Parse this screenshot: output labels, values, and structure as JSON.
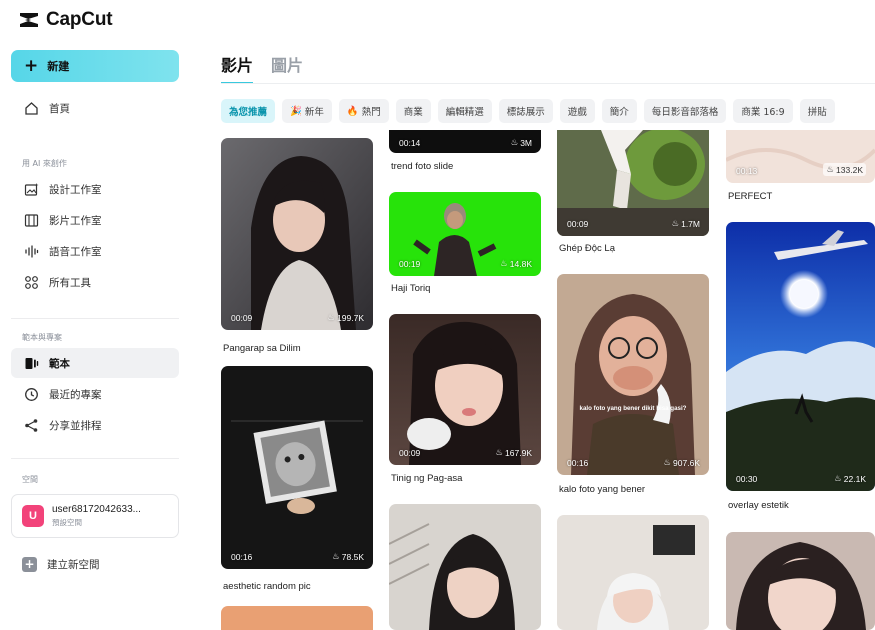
{
  "app": {
    "name": "CapCut"
  },
  "sidebar": {
    "new_label": "新建",
    "home_label": "首頁",
    "section_ai": "用 AI 來創作",
    "ai_items": [
      {
        "label": "設計工作室",
        "icon": "image-sparkle-icon"
      },
      {
        "label": "影片工作室",
        "icon": "film-icon"
      },
      {
        "label": "語音工作室",
        "icon": "waveform-icon"
      },
      {
        "label": "所有工具",
        "icon": "grid-icon"
      }
    ],
    "section_templates": "範本與專案",
    "template_items": [
      {
        "label": "範本",
        "icon": "template-icon"
      },
      {
        "label": "最近的專案",
        "icon": "clock-icon"
      },
      {
        "label": "分享並排程",
        "icon": "share-icon"
      }
    ],
    "section_space": "空間",
    "space": {
      "avatar_letter": "U",
      "name": "user68172042633...",
      "subtitle": "預設空間"
    },
    "new_space_label": "建立新空間"
  },
  "main": {
    "tabs": [
      "影片",
      "圖片"
    ],
    "chips": [
      "為您推薦",
      "新年",
      "熱門",
      "商業",
      "編輯精選",
      "標誌展示",
      "遊戲",
      "簡介",
      "每日影音部落格",
      "商業 16:9",
      "拼貼"
    ],
    "cards": [
      {
        "duration": "00:09",
        "views": "199.7K",
        "caption": "Pangarap sa Dilim"
      },
      {
        "duration": "00:16",
        "views": "78.5K",
        "caption": "aesthetic random pic"
      },
      {
        "duration": "00:14",
        "views": "3M",
        "caption": "trend foto slide"
      },
      {
        "duration": "00:19",
        "views": "14.8K",
        "caption": "Haji Toriq"
      },
      {
        "duration": "00:09",
        "views": "167.9K",
        "caption": "Tinig ng Pag-asa"
      },
      {
        "duration": "00:09",
        "views": "1.7M",
        "caption": "Ghép Độc Lạ"
      },
      {
        "duration": "00:16",
        "views": "907.6K",
        "caption": "kalo foto yang bener",
        "overlay": "kalo foto yang bener dikit bisa gasi?"
      },
      {
        "duration": "00:13",
        "views": "133.2K",
        "caption": "PERFECT"
      },
      {
        "duration": "00:30",
        "views": "22.1K",
        "caption": "overlay estetik"
      }
    ]
  },
  "colors": {
    "accent": "#38c9de",
    "new_button": "#56d6e8",
    "avatar": "#f2437a"
  }
}
